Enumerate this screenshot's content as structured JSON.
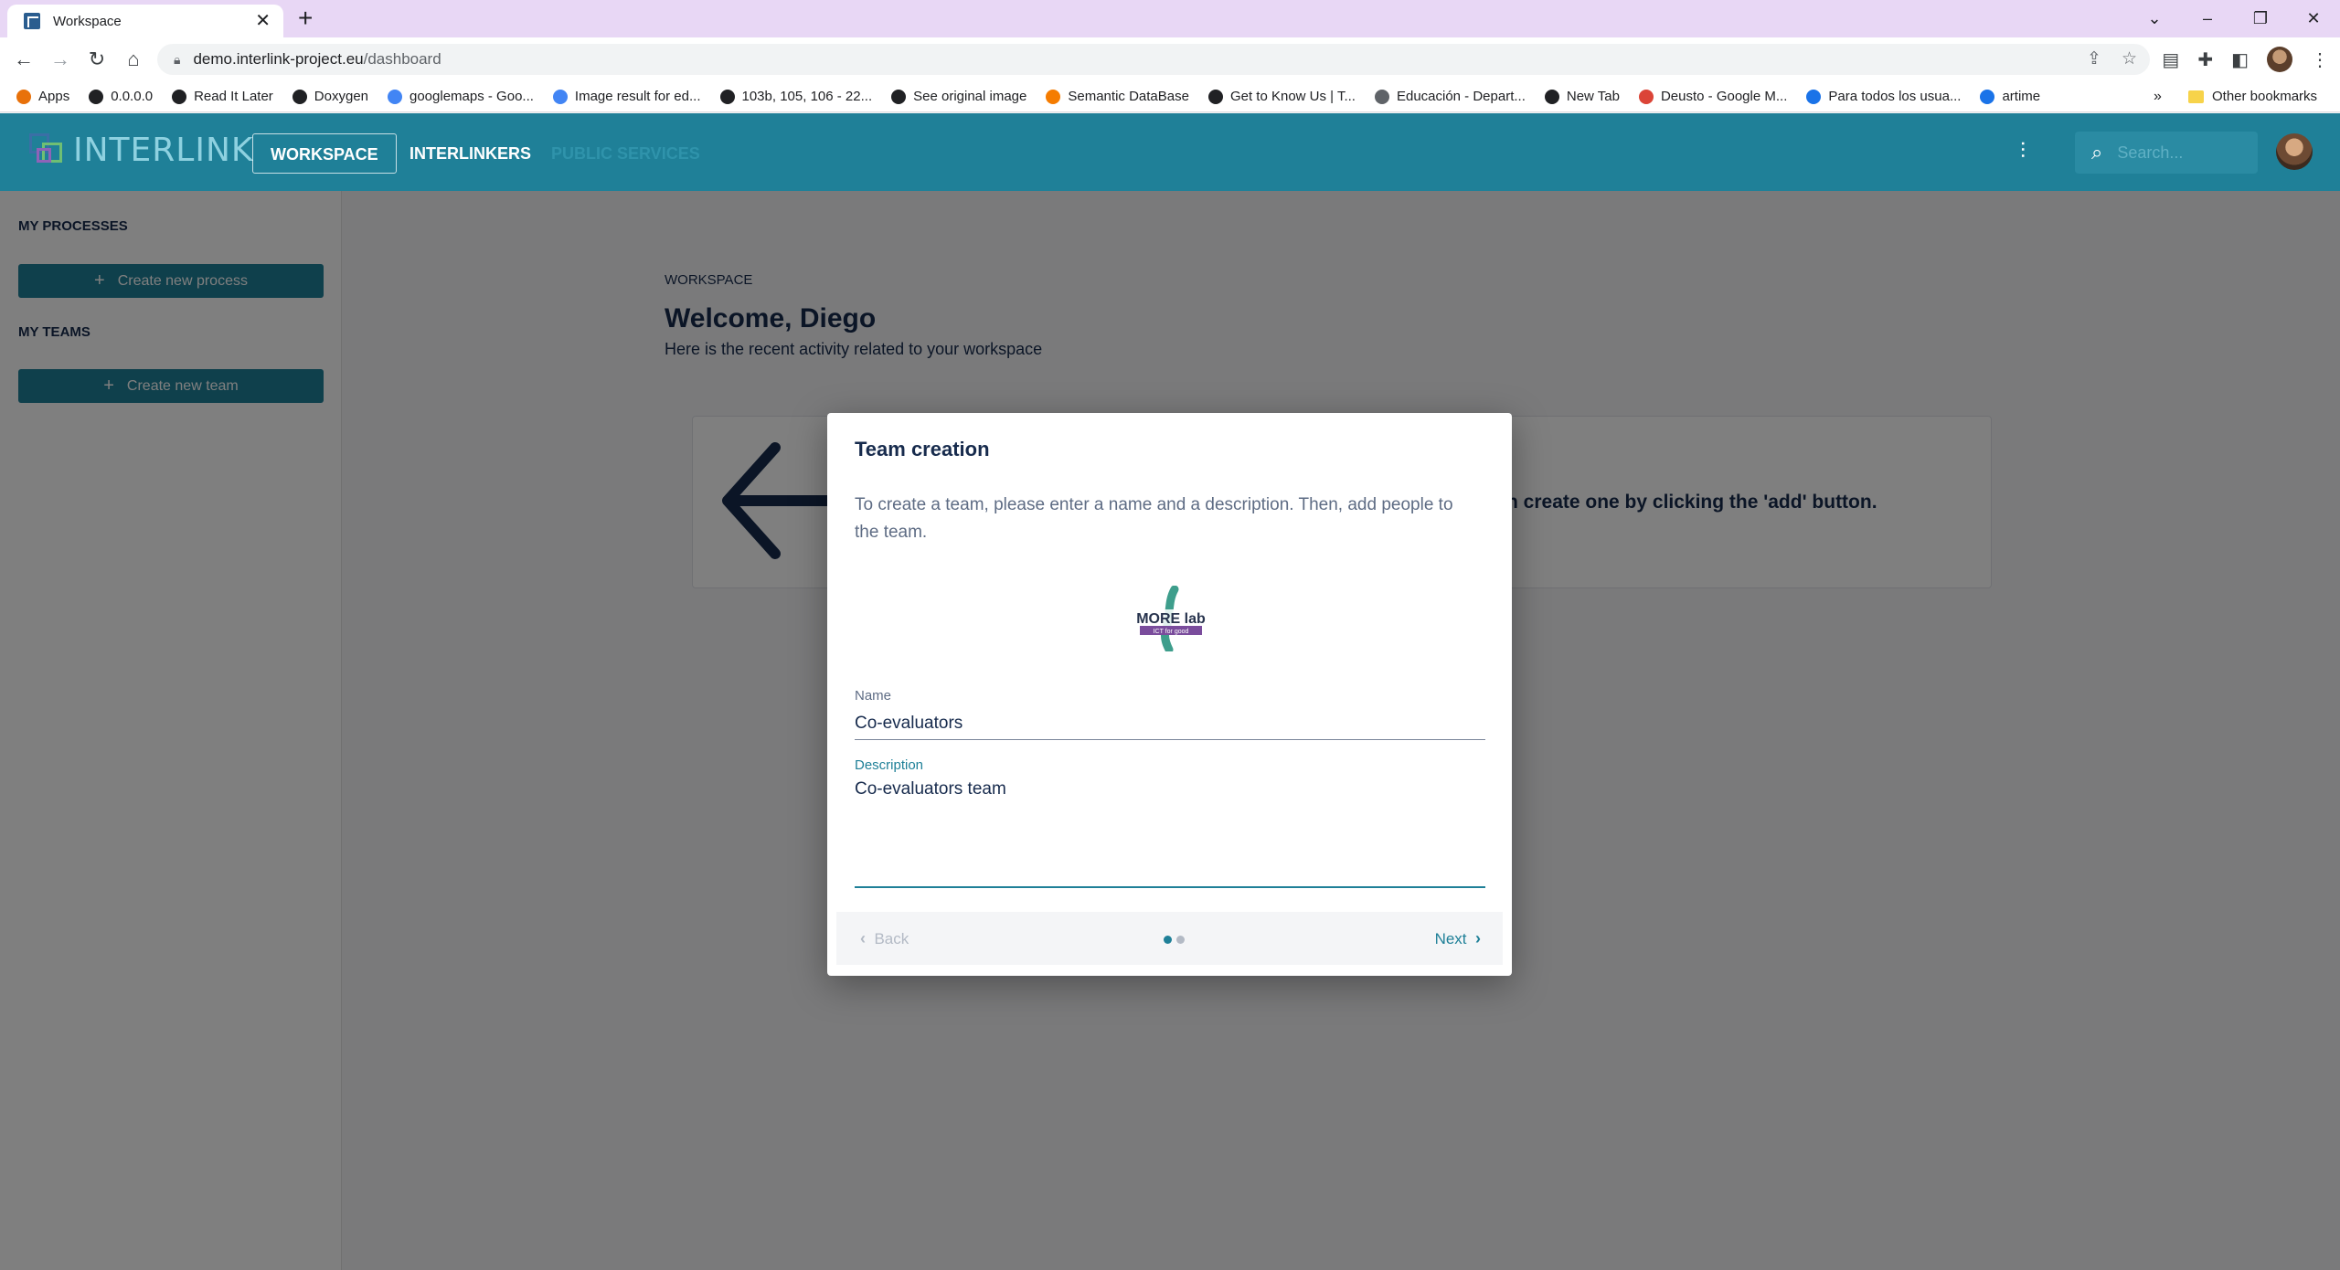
{
  "browser": {
    "tab_title": "Workspace",
    "url_host": "demo.interlink-project.eu",
    "url_path": "/dashboard",
    "bookmarks": [
      {
        "label": "Apps",
        "color": "#e8710a"
      },
      {
        "label": "0.0.0.0",
        "color": "#202124"
      },
      {
        "label": "Read It Later",
        "color": "#202124"
      },
      {
        "label": "Doxygen",
        "color": "#202124"
      },
      {
        "label": "googlemaps - Goo...",
        "color": "#4285f4"
      },
      {
        "label": "Image result for ed...",
        "color": "#4285f4"
      },
      {
        "label": "103b, 105, 106 - 22...",
        "color": "#202124"
      },
      {
        "label": "See original image",
        "color": "#202124"
      },
      {
        "label": "Semantic DataBase",
        "color": "#f57c00"
      },
      {
        "label": "Get to Know Us | T...",
        "color": "#202124"
      },
      {
        "label": "Educación - Depart...",
        "color": "#5f6368"
      },
      {
        "label": "New Tab",
        "color": "#202124"
      },
      {
        "label": "Deusto - Google M...",
        "color": "#db4437"
      },
      {
        "label": "Para todos los usua...",
        "color": "#1a73e8"
      },
      {
        "label": "artime",
        "color": "#1a73e8"
      }
    ],
    "bookmarks_more": "»",
    "other_bookmarks": "Other bookmarks"
  },
  "header": {
    "logo_text": "INTERLINK",
    "nav": [
      {
        "label": "WORKSPACE",
        "active": true
      },
      {
        "label": "INTERLINKERS",
        "active": false
      },
      {
        "label": "PUBLIC SERVICES",
        "active": false
      }
    ],
    "search_placeholder": "Search..."
  },
  "sidebar": {
    "processes_heading": "MY PROCESSES",
    "create_process": "Create new process",
    "teams_heading": "MY TEAMS",
    "create_team": "Create new team"
  },
  "main": {
    "breadcrumb": "WORKSPACE",
    "title": "Welcome, Diego",
    "subtitle": "Here is the recent activity related to your workspace",
    "empty_text_visible": "n create one by clicking the 'add' button."
  },
  "dialog": {
    "title": "Team creation",
    "description": "To create a team, please enter a name and a description. Then, add people to the team.",
    "logo_text": "MORE lab",
    "logo_tagline": "ICT for good",
    "name_label": "Name",
    "name_value": "Co-evaluators",
    "description_label": "Description",
    "description_value": "Co-evaluators team",
    "back_label": "Back",
    "next_label": "Next",
    "step_current": 1,
    "step_total": 2
  },
  "colors": {
    "brand": "#1f8098",
    "text": "#172b4d"
  }
}
